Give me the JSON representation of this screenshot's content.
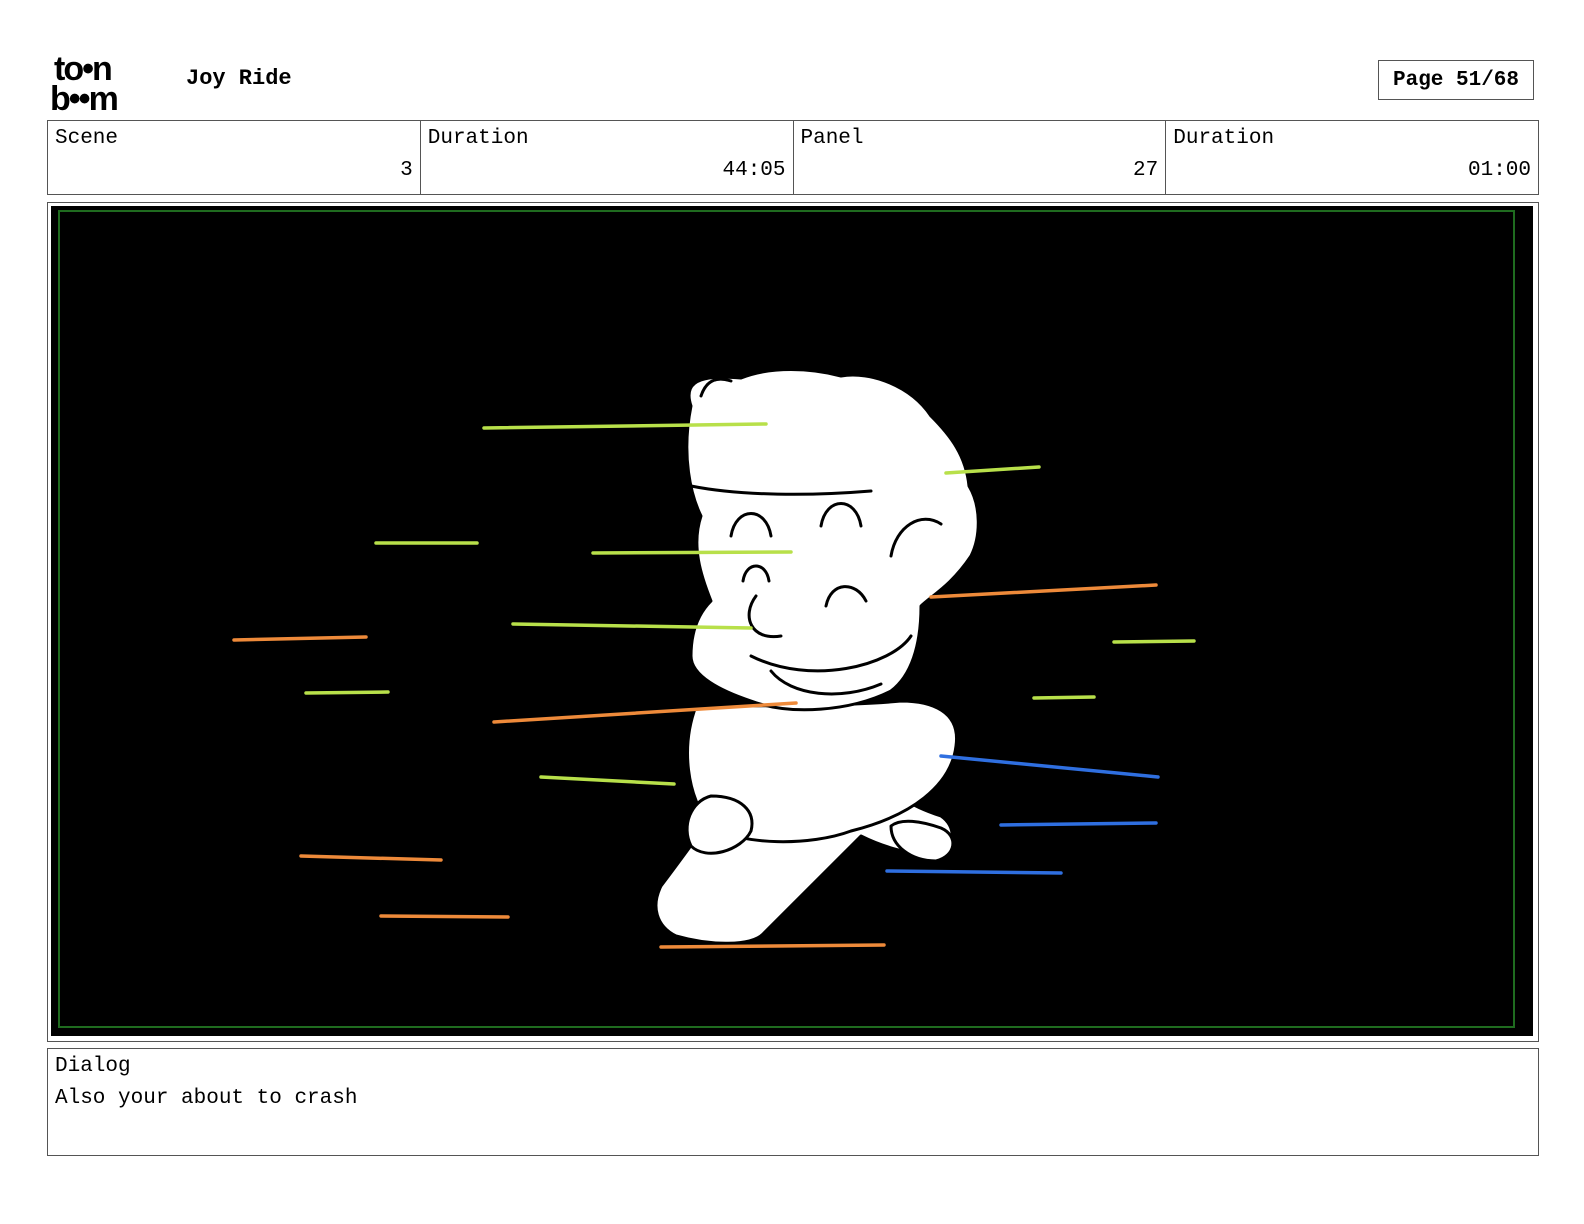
{
  "header": {
    "logo_text": [
      "to•n",
      "b••m"
    ],
    "project_title": "Joy Ride",
    "page_label": "Page 51/68"
  },
  "info": {
    "scene_label": "Scene",
    "scene_value": "3",
    "scene_duration_label": "Duration",
    "scene_duration_value": "44:05",
    "panel_label": "Panel",
    "panel_value": "27",
    "panel_duration_label": "Duration",
    "panel_duration_value": "01:00"
  },
  "dialog": {
    "label": "Dialog",
    "text": "Also your about to crash"
  },
  "colors": {
    "panel_background": "#000000",
    "panel_border": "#1f6b1f",
    "speed_line_green": "#b8e04a",
    "speed_line_orange": "#ee8a3a",
    "speed_line_blue": "#2f6fe0",
    "figure_fill": "#ffffff",
    "figure_stroke": "#000000"
  }
}
